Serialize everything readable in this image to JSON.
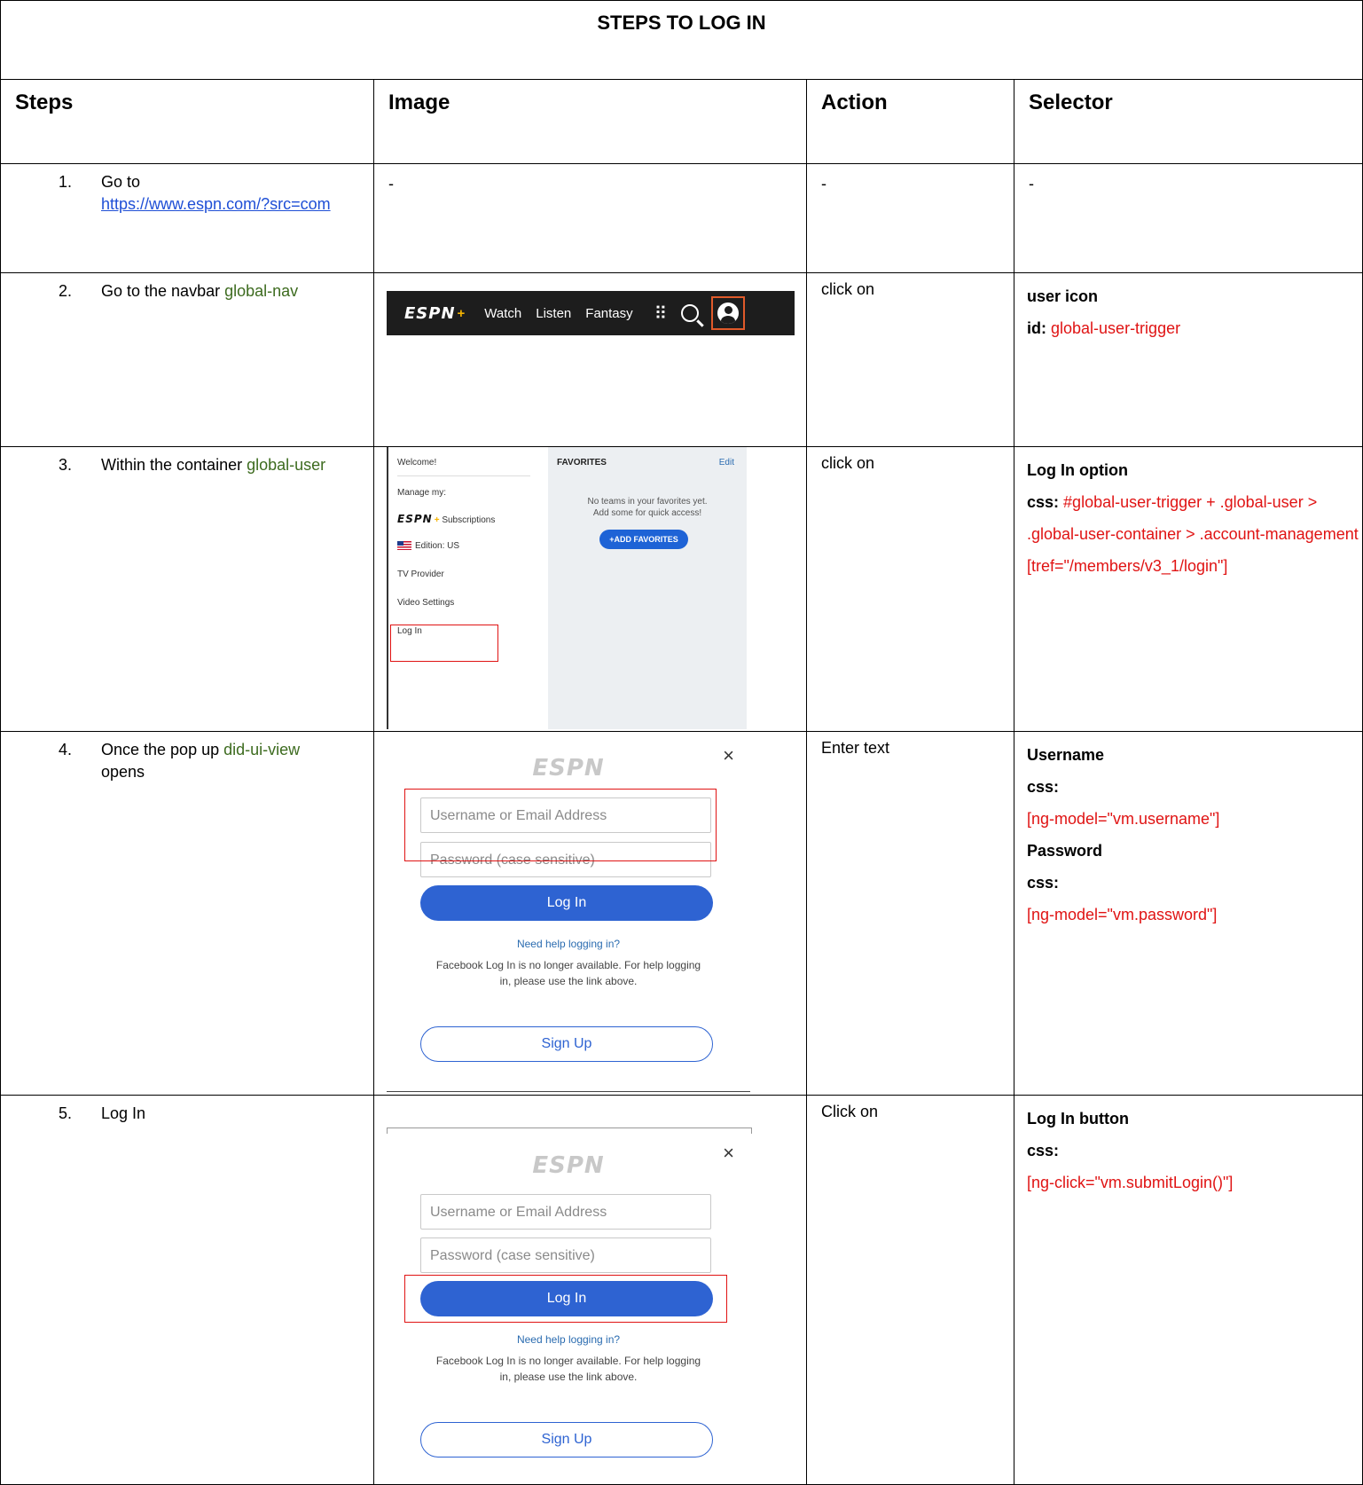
{
  "title": "STEPS TO LOG IN",
  "headers": {
    "steps": "Steps",
    "image": "Image",
    "action": "Action",
    "selector": "Selector"
  },
  "rows": [
    {
      "num": "1.",
      "text_a": "Go to",
      "link": "https://www.espn.com/?src=com",
      "image": "-",
      "action": "-",
      "selector": "-"
    },
    {
      "num": "2.",
      "text_a": "Go to the navbar ",
      "code": "global-nav",
      "action": "click on",
      "sel_title": "user icon",
      "sel_key": "id:",
      "sel_val": "global-user-trigger"
    },
    {
      "num": "3.",
      "text_a": "Within the container ",
      "code": "global-user",
      "action": "click on",
      "sel_title": "Log In option",
      "sel_key": "css:",
      "sel_val": "#global-user-trigger + .global-user > .global-user-container > .account-management [tref=\"/members/v3_1/login\"]"
    },
    {
      "num": "4.",
      "text_a": "Once the pop up ",
      "code": "did-ui-view",
      "text_b": "opens",
      "action": "Enter text",
      "sel_title": "Username",
      "sel_key": "css:",
      "sel_val": "[ng-model=\"vm.username\"]",
      "sel_title2": "Password",
      "sel_key2": "css:",
      "sel_val2": "[ng-model=\"vm.password\"]"
    },
    {
      "num": "5.",
      "text_a": "Log In",
      "action": "Click on",
      "sel_title": "Log In button",
      "sel_key": "css:",
      "sel_val": "[ng-click=\"vm.submitLogin()\"]"
    }
  ],
  "navbar": {
    "logo": "ESPN",
    "plus": "+",
    "items": [
      "Watch",
      "Listen",
      "Fantasy"
    ],
    "grid_glyph": "⠿"
  },
  "usermenu": {
    "welcome": "Welcome!",
    "manage": "Manage my:",
    "logo": "ESPN",
    "plus": "+",
    "subscriptions": "Subscriptions",
    "edition": "Edition: US",
    "tv": "TV Provider",
    "video": "Video Settings",
    "login": "Log In",
    "fav_title": "FAVORITES",
    "fav_edit": "Edit",
    "fav_msg1": "No teams in your favorites yet.",
    "fav_msg2": "Add some for quick access!",
    "fav_btn": "+ADD FAVORITES"
  },
  "popup": {
    "logo": "ESPN",
    "close": "×",
    "username_placeholder": "Username or Email Address",
    "password_placeholder": "Password (case sensitive)",
    "login_btn": "Log In",
    "help": "Need help logging in?",
    "fb1": "Facebook Log In is no longer available. For help logging",
    "fb2": "in, please use the link above.",
    "signup": "Sign Up"
  },
  "colors": {
    "highlight": "#e01313",
    "code": "#3d6b1f",
    "link": "#1f4fd6",
    "button": "#2e63d2"
  }
}
